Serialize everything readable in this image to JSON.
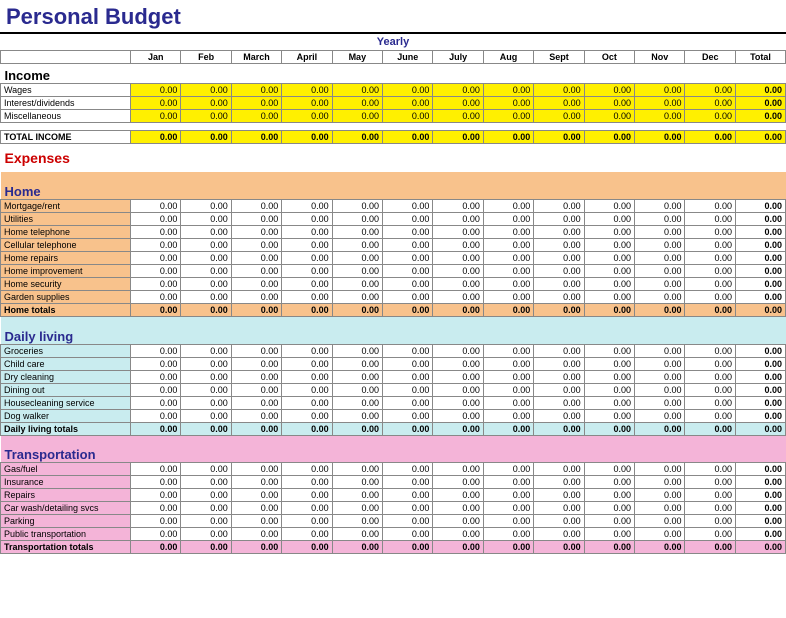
{
  "title": "Personal Budget",
  "yearly_label": "Yearly",
  "months": [
    "Jan",
    "Feb",
    "March",
    "April",
    "May",
    "June",
    "July",
    "Aug",
    "Sept",
    "Oct",
    "Nov",
    "Dec"
  ],
  "total_label": "Total",
  "income": {
    "heading": "Income",
    "rows": [
      {
        "label": "Wages",
        "values": [
          "0.00",
          "0.00",
          "0.00",
          "0.00",
          "0.00",
          "0.00",
          "0.00",
          "0.00",
          "0.00",
          "0.00",
          "0.00",
          "0.00"
        ],
        "total": "0.00"
      },
      {
        "label": "Interest/dividends",
        "values": [
          "0.00",
          "0.00",
          "0.00",
          "0.00",
          "0.00",
          "0.00",
          "0.00",
          "0.00",
          "0.00",
          "0.00",
          "0.00",
          "0.00"
        ],
        "total": "0.00"
      },
      {
        "label": "Miscellaneous",
        "values": [
          "0.00",
          "0.00",
          "0.00",
          "0.00",
          "0.00",
          "0.00",
          "0.00",
          "0.00",
          "0.00",
          "0.00",
          "0.00",
          "0.00"
        ],
        "total": "0.00"
      }
    ],
    "total_row": {
      "label": "TOTAL INCOME",
      "values": [
        "0.00",
        "0.00",
        "0.00",
        "0.00",
        "0.00",
        "0.00",
        "0.00",
        "0.00",
        "0.00",
        "0.00",
        "0.00",
        "0.00"
      ],
      "total": "0.00"
    }
  },
  "expenses_heading": "Expenses",
  "categories": [
    {
      "name": "Home",
      "bg": "bg-orange",
      "rows": [
        {
          "label": "Mortgage/rent",
          "values": [
            "0.00",
            "0.00",
            "0.00",
            "0.00",
            "0.00",
            "0.00",
            "0.00",
            "0.00",
            "0.00",
            "0.00",
            "0.00",
            "0.00"
          ],
          "total": "0.00"
        },
        {
          "label": "Utilities",
          "values": [
            "0.00",
            "0.00",
            "0.00",
            "0.00",
            "0.00",
            "0.00",
            "0.00",
            "0.00",
            "0.00",
            "0.00",
            "0.00",
            "0.00"
          ],
          "total": "0.00"
        },
        {
          "label": "Home telephone",
          "values": [
            "0.00",
            "0.00",
            "0.00",
            "0.00",
            "0.00",
            "0.00",
            "0.00",
            "0.00",
            "0.00",
            "0.00",
            "0.00",
            "0.00"
          ],
          "total": "0.00"
        },
        {
          "label": "Cellular telephone",
          "values": [
            "0.00",
            "0.00",
            "0.00",
            "0.00",
            "0.00",
            "0.00",
            "0.00",
            "0.00",
            "0.00",
            "0.00",
            "0.00",
            "0.00"
          ],
          "total": "0.00"
        },
        {
          "label": "Home repairs",
          "values": [
            "0.00",
            "0.00",
            "0.00",
            "0.00",
            "0.00",
            "0.00",
            "0.00",
            "0.00",
            "0.00",
            "0.00",
            "0.00",
            "0.00"
          ],
          "total": "0.00"
        },
        {
          "label": "Home improvement",
          "values": [
            "0.00",
            "0.00",
            "0.00",
            "0.00",
            "0.00",
            "0.00",
            "0.00",
            "0.00",
            "0.00",
            "0.00",
            "0.00",
            "0.00"
          ],
          "total": "0.00"
        },
        {
          "label": "Home security",
          "values": [
            "0.00",
            "0.00",
            "0.00",
            "0.00",
            "0.00",
            "0.00",
            "0.00",
            "0.00",
            "0.00",
            "0.00",
            "0.00",
            "0.00"
          ],
          "total": "0.00"
        },
        {
          "label": "Garden supplies",
          "values": [
            "0.00",
            "0.00",
            "0.00",
            "0.00",
            "0.00",
            "0.00",
            "0.00",
            "0.00",
            "0.00",
            "0.00",
            "0.00",
            "0.00"
          ],
          "total": "0.00"
        }
      ],
      "total_row": {
        "label": "Home totals",
        "values": [
          "0.00",
          "0.00",
          "0.00",
          "0.00",
          "0.00",
          "0.00",
          "0.00",
          "0.00",
          "0.00",
          "0.00",
          "0.00",
          "0.00"
        ],
        "total": "0.00"
      }
    },
    {
      "name": "Daily living",
      "bg": "bg-cyan",
      "rows": [
        {
          "label": "Groceries",
          "values": [
            "0.00",
            "0.00",
            "0.00",
            "0.00",
            "0.00",
            "0.00",
            "0.00",
            "0.00",
            "0.00",
            "0.00",
            "0.00",
            "0.00"
          ],
          "total": "0.00"
        },
        {
          "label": "Child care",
          "values": [
            "0.00",
            "0.00",
            "0.00",
            "0.00",
            "0.00",
            "0.00",
            "0.00",
            "0.00",
            "0.00",
            "0.00",
            "0.00",
            "0.00"
          ],
          "total": "0.00"
        },
        {
          "label": "Dry cleaning",
          "values": [
            "0.00",
            "0.00",
            "0.00",
            "0.00",
            "0.00",
            "0.00",
            "0.00",
            "0.00",
            "0.00",
            "0.00",
            "0.00",
            "0.00"
          ],
          "total": "0.00"
        },
        {
          "label": "Dining out",
          "values": [
            "0.00",
            "0.00",
            "0.00",
            "0.00",
            "0.00",
            "0.00",
            "0.00",
            "0.00",
            "0.00",
            "0.00",
            "0.00",
            "0.00"
          ],
          "total": "0.00"
        },
        {
          "label": "Housecleaning service",
          "values": [
            "0.00",
            "0.00",
            "0.00",
            "0.00",
            "0.00",
            "0.00",
            "0.00",
            "0.00",
            "0.00",
            "0.00",
            "0.00",
            "0.00"
          ],
          "total": "0.00"
        },
        {
          "label": "Dog walker",
          "values": [
            "0.00",
            "0.00",
            "0.00",
            "0.00",
            "0.00",
            "0.00",
            "0.00",
            "0.00",
            "0.00",
            "0.00",
            "0.00",
            "0.00"
          ],
          "total": "0.00"
        }
      ],
      "total_row": {
        "label": "Daily living totals",
        "values": [
          "0.00",
          "0.00",
          "0.00",
          "0.00",
          "0.00",
          "0.00",
          "0.00",
          "0.00",
          "0.00",
          "0.00",
          "0.00",
          "0.00"
        ],
        "total": "0.00"
      }
    },
    {
      "name": "Transportation",
      "bg": "bg-pink",
      "rows": [
        {
          "label": "Gas/fuel",
          "values": [
            "0.00",
            "0.00",
            "0.00",
            "0.00",
            "0.00",
            "0.00",
            "0.00",
            "0.00",
            "0.00",
            "0.00",
            "0.00",
            "0.00"
          ],
          "total": "0.00"
        },
        {
          "label": "Insurance",
          "values": [
            "0.00",
            "0.00",
            "0.00",
            "0.00",
            "0.00",
            "0.00",
            "0.00",
            "0.00",
            "0.00",
            "0.00",
            "0.00",
            "0.00"
          ],
          "total": "0.00"
        },
        {
          "label": "Repairs",
          "values": [
            "0.00",
            "0.00",
            "0.00",
            "0.00",
            "0.00",
            "0.00",
            "0.00",
            "0.00",
            "0.00",
            "0.00",
            "0.00",
            "0.00"
          ],
          "total": "0.00"
        },
        {
          "label": "Car wash/detailing svcs",
          "values": [
            "0.00",
            "0.00",
            "0.00",
            "0.00",
            "0.00",
            "0.00",
            "0.00",
            "0.00",
            "0.00",
            "0.00",
            "0.00",
            "0.00"
          ],
          "total": "0.00"
        },
        {
          "label": "Parking",
          "values": [
            "0.00",
            "0.00",
            "0.00",
            "0.00",
            "0.00",
            "0.00",
            "0.00",
            "0.00",
            "0.00",
            "0.00",
            "0.00",
            "0.00"
          ],
          "total": "0.00"
        },
        {
          "label": "Public transportation",
          "values": [
            "0.00",
            "0.00",
            "0.00",
            "0.00",
            "0.00",
            "0.00",
            "0.00",
            "0.00",
            "0.00",
            "0.00",
            "0.00",
            "0.00"
          ],
          "total": "0.00"
        }
      ],
      "total_row": {
        "label": "Transportation totals",
        "values": [
          "0.00",
          "0.00",
          "0.00",
          "0.00",
          "0.00",
          "0.00",
          "0.00",
          "0.00",
          "0.00",
          "0.00",
          "0.00",
          "0.00"
        ],
        "total": "0.00"
      }
    }
  ]
}
